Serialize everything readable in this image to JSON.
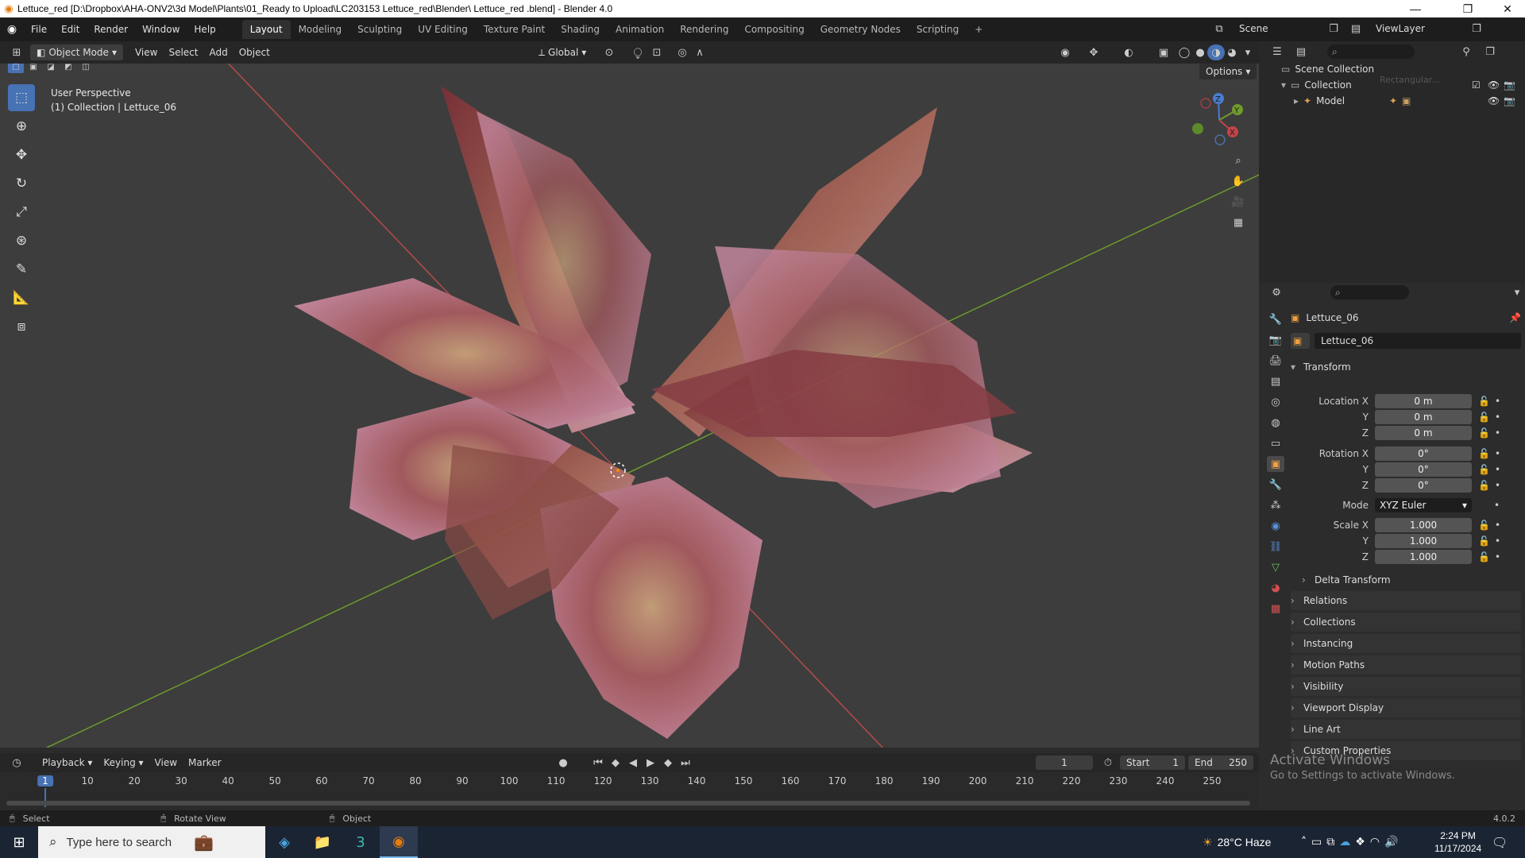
{
  "window": {
    "title": "Lettuce_red  [D:\\Dropbox\\AHA-ONV2\\3d Model\\Plants\\01_Ready to Upload\\LC203153 Lettuce_red\\Blender\\ Lettuce_red .blend] - Blender 4.0",
    "minimize": "—",
    "maximize": "❐",
    "close": "✕"
  },
  "menu": [
    "File",
    "Edit",
    "Render",
    "Window",
    "Help"
  ],
  "workspaces": [
    "Layout",
    "Modeling",
    "Sculpting",
    "UV Editing",
    "Texture Paint",
    "Shading",
    "Animation",
    "Rendering",
    "Compositing",
    "Geometry Nodes",
    "Scripting"
  ],
  "active_workspace": "Layout",
  "add_workspace": "+",
  "scene": {
    "name": "Scene",
    "view_layer": "ViewLayer"
  },
  "viewport_header": {
    "mode": "Object Mode",
    "menus": [
      "View",
      "Select",
      "Add",
      "Object"
    ],
    "transform_orientation": "Global",
    "options": "Options"
  },
  "viewport": {
    "perspective": "User Perspective",
    "collection_info": "(1) Collection | Lettuce_06",
    "axes": {
      "x": "X",
      "y": "Y",
      "z": "Z"
    }
  },
  "outliner": {
    "root": "Scene Collection",
    "items": [
      {
        "label": "Collection",
        "extra": "Rectangular..."
      },
      {
        "label": "Model"
      }
    ]
  },
  "properties": {
    "object_name": "Lettuce_06",
    "data_name": "Lettuce_06",
    "transform_title": "Transform",
    "location": {
      "label_x": "Location X",
      "label_y": "Y",
      "label_z": "Z",
      "x": "0 m",
      "y": "0 m",
      "z": "0 m"
    },
    "rotation": {
      "label_x": "Rotation X",
      "label_y": "Y",
      "label_z": "Z",
      "x": "0°",
      "y": "0°",
      "z": "0°"
    },
    "mode": {
      "label": "Mode",
      "value": "XYZ Euler"
    },
    "scale": {
      "label_x": "Scale X",
      "label_y": "Y",
      "label_z": "Z",
      "x": "1.000",
      "y": "1.000",
      "z": "1.000"
    },
    "delta_transform": "Delta Transform",
    "sections": [
      "Relations",
      "Collections",
      "Instancing",
      "Motion Paths",
      "Visibility",
      "Viewport Display",
      "Line Art",
      "Custom Properties"
    ]
  },
  "timeline": {
    "menus": [
      "Playback",
      "Keying",
      "View",
      "Marker"
    ],
    "current_frame": "1",
    "start_label": "Start",
    "start": "1",
    "end_label": "End",
    "end": "250",
    "ticks": [
      "1",
      "10",
      "20",
      "30",
      "40",
      "50",
      "60",
      "70",
      "80",
      "90",
      "100",
      "110",
      "120",
      "130",
      "140",
      "150",
      "160",
      "170",
      "180",
      "190",
      "200",
      "210",
      "220",
      "230",
      "240",
      "250"
    ]
  },
  "statusbar": {
    "select": "Select",
    "rotate": "Rotate View",
    "object": "Object",
    "version": "4.0.2"
  },
  "activate_windows": {
    "title": "Activate Windows",
    "subtitle": "Go to Settings to activate Windows."
  },
  "taskbar": {
    "search_placeholder": "Type here to search",
    "weather": "28°C  Haze",
    "time": "2:24 PM",
    "date": "11/17/2024"
  }
}
